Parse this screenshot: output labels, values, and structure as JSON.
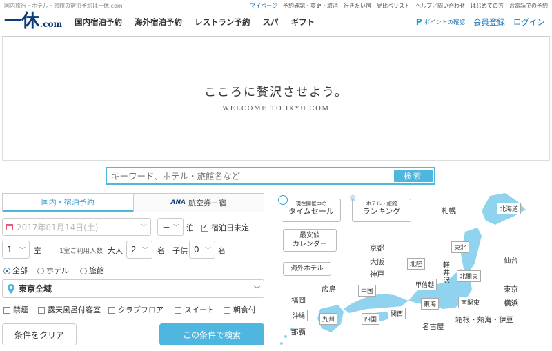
{
  "header": {
    "tagline": "国内旅行・ホテル・旅館の宿泊予約は一休.com",
    "util_links": [
      "マイページ",
      "予約確認・変更・取消",
      "行きたい宿",
      "見比べリスト",
      "ヘルプ／問い合わせ",
      "はじめての方",
      "お電話での予約"
    ],
    "logo_mark": "一休",
    "logo_domain": ".com",
    "nav": [
      "国内宿泊予約",
      "海外宿泊予約",
      "レストラン予約",
      "スパ",
      "ギフト"
    ],
    "points_icon": "P",
    "points_label": "ポイントの確認",
    "register": "会員登録",
    "login": "ログイン"
  },
  "hero": {
    "headline": "こころに贅沢させよう。",
    "subline": "WELCOME TO IKYU.COM"
  },
  "search": {
    "placeholder": "キーワード、ホテル・旅館名など",
    "button": "検索"
  },
  "tabs": {
    "domestic": "国内・宿泊予約",
    "ana_logo": "ANA",
    "ana": "航空券＋宿"
  },
  "form": {
    "date": "2017年01月14日(土)",
    "nights": "－",
    "nights_unit": "泊",
    "undecided": "宿泊日未定",
    "rooms": "1",
    "rooms_unit": "室",
    "per_room": "1室ご利用人数",
    "adult_label": "大人",
    "adults": "2",
    "adult_unit": "名",
    "child_label": "子供",
    "children": "0",
    "child_unit": "名",
    "type_all": "全部",
    "type_hotel": "ホテル",
    "type_ryokan": "旅館",
    "area": "東京全域",
    "filters": [
      "禁煙",
      "露天風呂付客室",
      "クラブフロア",
      "スイート",
      "朝食付"
    ],
    "clear": "条件をクリア",
    "submit": "この条件で検索"
  },
  "map": {
    "timesale_small": "現在開催中の",
    "timesale": "タイムセール",
    "ranking_small": "ホテル・旅館",
    "ranking": "ランキング",
    "calendar_1": "最安値",
    "calendar_2": "カレンダー",
    "overseas": "海外ホテル",
    "regions": [
      "北海道",
      "東北",
      "北関東",
      "南関東",
      "北陸",
      "甲信越",
      "東海",
      "中国",
      "四国",
      "関西",
      "九州",
      "沖縄"
    ],
    "cities": [
      "札幌",
      "仙台",
      "東京",
      "横浜",
      "箱根・熱海・伊豆",
      "名古屋",
      "京都",
      "大阪",
      "神戸",
      "広島",
      "福岡",
      "那覇",
      "軽井沢"
    ],
    "sea_color": "#ffffff",
    "land_color": "#8fd3ee"
  }
}
